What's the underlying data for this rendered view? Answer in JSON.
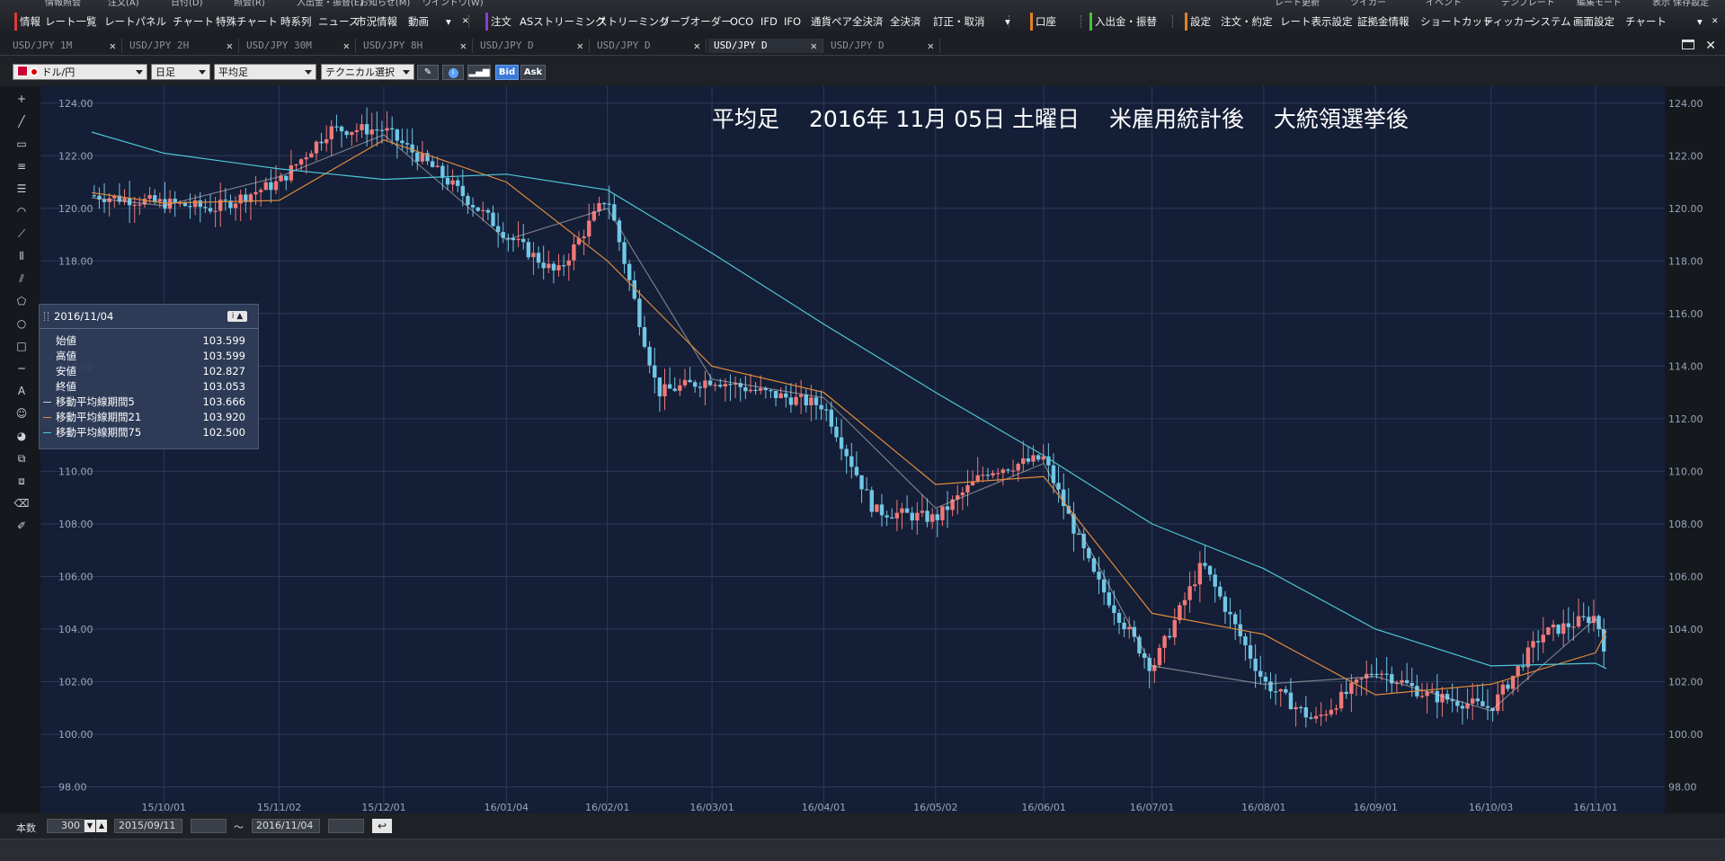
{
  "menu": {
    "top_items": [
      "情報照会",
      "注文(A)",
      "日付(D)",
      "照会(R)",
      "入出金・振替(E)",
      "お知らせ(M)",
      "ウインドウ(W)"
    ],
    "main_items": [
      {
        "label": "情報",
        "tag": "#e03b3b"
      },
      {
        "label": "レート一覧"
      },
      {
        "label": "レートパネル"
      },
      {
        "label": "チャート"
      },
      {
        "label": "特殊チャート"
      },
      {
        "label": "時系列"
      },
      {
        "label": "ニュース"
      },
      {
        "label": "市況情報"
      },
      {
        "label": "動画"
      },
      {
        "label": "注文",
        "tag": "#8a3bd6"
      },
      {
        "label": "ASストリーミング"
      },
      {
        "label": "ストリーミング"
      },
      {
        "label": "リーブオーダー"
      },
      {
        "label": "OCO"
      },
      {
        "label": "IFD"
      },
      {
        "label": "IFO"
      },
      {
        "label": "通貨ペア全決済"
      },
      {
        "label": "全決済"
      },
      {
        "label": "訂正・取消"
      },
      {
        "label": "口座",
        "tag": "#e0822b"
      },
      {
        "label": "入出金・振替",
        "tag": "#4bbf3b"
      },
      {
        "label": "設定",
        "tag": "#e0822b"
      },
      {
        "label": "注文・約定"
      },
      {
        "label": "レート表示設定"
      },
      {
        "label": "証拠金情報"
      },
      {
        "label": "ショートカット"
      },
      {
        "label": "ティッカー"
      },
      {
        "label": "システム"
      },
      {
        "label": "画面設定"
      },
      {
        "label": "チャート"
      }
    ],
    "right_badges": [
      "レート更新",
      "ツイカー",
      "イベント",
      "テンプレート",
      "編集モード",
      "表示 保存設定"
    ]
  },
  "tabs": [
    {
      "label": "USD/JPY 1M",
      "active": false
    },
    {
      "label": "USD/JPY 2H",
      "active": false
    },
    {
      "label": "USD/JPY 30M",
      "active": false
    },
    {
      "label": "USD/JPY 8H",
      "active": false
    },
    {
      "label": "USD/JPY D",
      "active": false
    },
    {
      "label": "USD/JPY D",
      "active": false
    },
    {
      "label": "USD/JPY D",
      "active": true
    },
    {
      "label": "USD/JPY D",
      "active": false
    }
  ],
  "toolbar": {
    "pair": "ドル/円",
    "timeframe": "日足",
    "chart_type": "平均足",
    "technical": "テクニカル選択",
    "bid": "Bid",
    "ask": "Ask"
  },
  "draw_tools": [
    "crosshair-icon",
    "line-icon",
    "ruler-icon",
    "hlines-icon",
    "hlines-dense-icon",
    "arc-icon",
    "fan-icon",
    "vlines-icon",
    "channel-icon",
    "pentagon-icon",
    "circle-icon",
    "rectangle-icon",
    "hline-icon",
    "text-icon",
    "face-icon",
    "paint-icon",
    "copy-icon",
    "duplicate-icon",
    "eraser-icon",
    "eraser-all-icon"
  ],
  "status": {
    "count_label": "本数",
    "count": "300",
    "from": "2015/09/11",
    "tilde": "〜",
    "to": "2016/11/04"
  },
  "chart_data": {
    "type": "line",
    "title": "平均足　 2016年 11月 05日 土曜日　 米雇用統計後　 大統領選挙後",
    "y_ticks": [
      "124.00",
      "122.00",
      "120.00",
      "118.00",
      "116.00",
      "114.00",
      "112.00",
      "110.00",
      "108.00",
      "106.00",
      "104.00",
      "102.00",
      "100.00",
      "98.00"
    ],
    "ylim": [
      97.3,
      124.3
    ],
    "x_ticks": [
      "15/10/01",
      "15/11/02",
      "15/12/01",
      "16/01/04",
      "16/02/01",
      "16/03/01",
      "16/04/01",
      "16/05/02",
      "16/06/01",
      "16/07/01",
      "16/08/01",
      "16/09/01",
      "16/10/03",
      "16/11/01"
    ],
    "grid": true,
    "candle_colors": {
      "up": "#f07878",
      "down": "#70c7e6"
    },
    "series": [
      {
        "kind": "heikin-ashi",
        "color": "#f07878",
        "x": [
          "15/09/11",
          "15/10/01",
          "15/10/15",
          "15/11/02",
          "15/11/16",
          "15/12/01",
          "15/12/15",
          "16/01/04",
          "16/01/18",
          "16/02/01",
          "16/02/15",
          "16/03/01",
          "16/03/15",
          "16/04/01",
          "16/04/15",
          "16/05/02",
          "16/05/16",
          "16/06/01",
          "16/06/15",
          "16/07/01",
          "16/07/15",
          "16/08/01",
          "16/08/15",
          "16/09/01",
          "16/09/15",
          "16/10/03",
          "16/10/17",
          "16/11/01",
          "16/11/04"
        ],
        "values": [
          120.5,
          120.2,
          120.0,
          121.0,
          123.0,
          123.0,
          121.5,
          119.0,
          117.5,
          120.5,
          113.0,
          113.5,
          113.0,
          112.5,
          108.5,
          108.2,
          110.0,
          110.5,
          106.0,
          102.5,
          106.5,
          102.0,
          100.5,
          102.5,
          101.5,
          101.0,
          103.8,
          104.5,
          103.05
        ]
      },
      {
        "name": "移動平均線期間5",
        "color": "#c9c9c9",
        "x": [
          "15/09/11",
          "15/10/01",
          "15/11/02",
          "15/12/01",
          "16/01/04",
          "16/02/01",
          "16/03/01",
          "16/04/01",
          "16/05/02",
          "16/06/01",
          "16/07/01",
          "16/08/01",
          "16/09/01",
          "16/10/03",
          "16/11/01",
          "16/11/04"
        ],
        "values": [
          120.4,
          120.1,
          121.2,
          122.8,
          118.8,
          120.0,
          113.5,
          112.8,
          108.6,
          110.3,
          102.6,
          101.9,
          102.2,
          100.9,
          104.4,
          103.67
        ]
      },
      {
        "name": "移動平均線期間21",
        "color": "#e08a3c",
        "x": [
          "15/09/11",
          "15/10/01",
          "15/11/02",
          "15/12/01",
          "16/01/04",
          "16/02/01",
          "16/03/01",
          "16/04/01",
          "16/05/02",
          "16/06/01",
          "16/07/01",
          "16/08/01",
          "16/09/01",
          "16/10/03",
          "16/11/01",
          "16/11/04"
        ],
        "values": [
          120.6,
          120.2,
          120.3,
          122.6,
          121.0,
          118.0,
          114.0,
          113.0,
          109.5,
          109.8,
          104.6,
          103.8,
          101.5,
          101.9,
          103.1,
          103.92
        ]
      },
      {
        "name": "移動平均線期間75",
        "color": "#4fc6d8",
        "x": [
          "15/09/11",
          "15/10/01",
          "15/11/02",
          "15/12/01",
          "16/01/04",
          "16/02/01",
          "16/03/01",
          "16/04/01",
          "16/05/02",
          "16/06/01",
          "16/07/01",
          "16/08/01",
          "16/09/01",
          "16/10/03",
          "16/11/01",
          "16/11/04"
        ],
        "values": [
          122.9,
          122.1,
          121.5,
          121.1,
          121.3,
          120.7,
          118.3,
          115.6,
          113.0,
          110.6,
          108.0,
          106.3,
          104.0,
          102.6,
          102.7,
          102.5
        ]
      }
    ]
  },
  "info_panel": {
    "date": "2016/11/04",
    "rows": [
      {
        "label": "始値",
        "value": "103.599"
      },
      {
        "label": "高値",
        "value": "103.599"
      },
      {
        "label": "安値",
        "value": "102.827"
      },
      {
        "label": "終値",
        "value": "103.053"
      },
      {
        "label": "移動平均線期間5",
        "value": "103.666",
        "color": "#c9c9c9"
      },
      {
        "label": "移動平均線期間21",
        "value": "103.920",
        "color": "#e08a3c"
      },
      {
        "label": "移動平均線期間75",
        "value": "102.500",
        "color": "#4fc6d8"
      }
    ]
  }
}
